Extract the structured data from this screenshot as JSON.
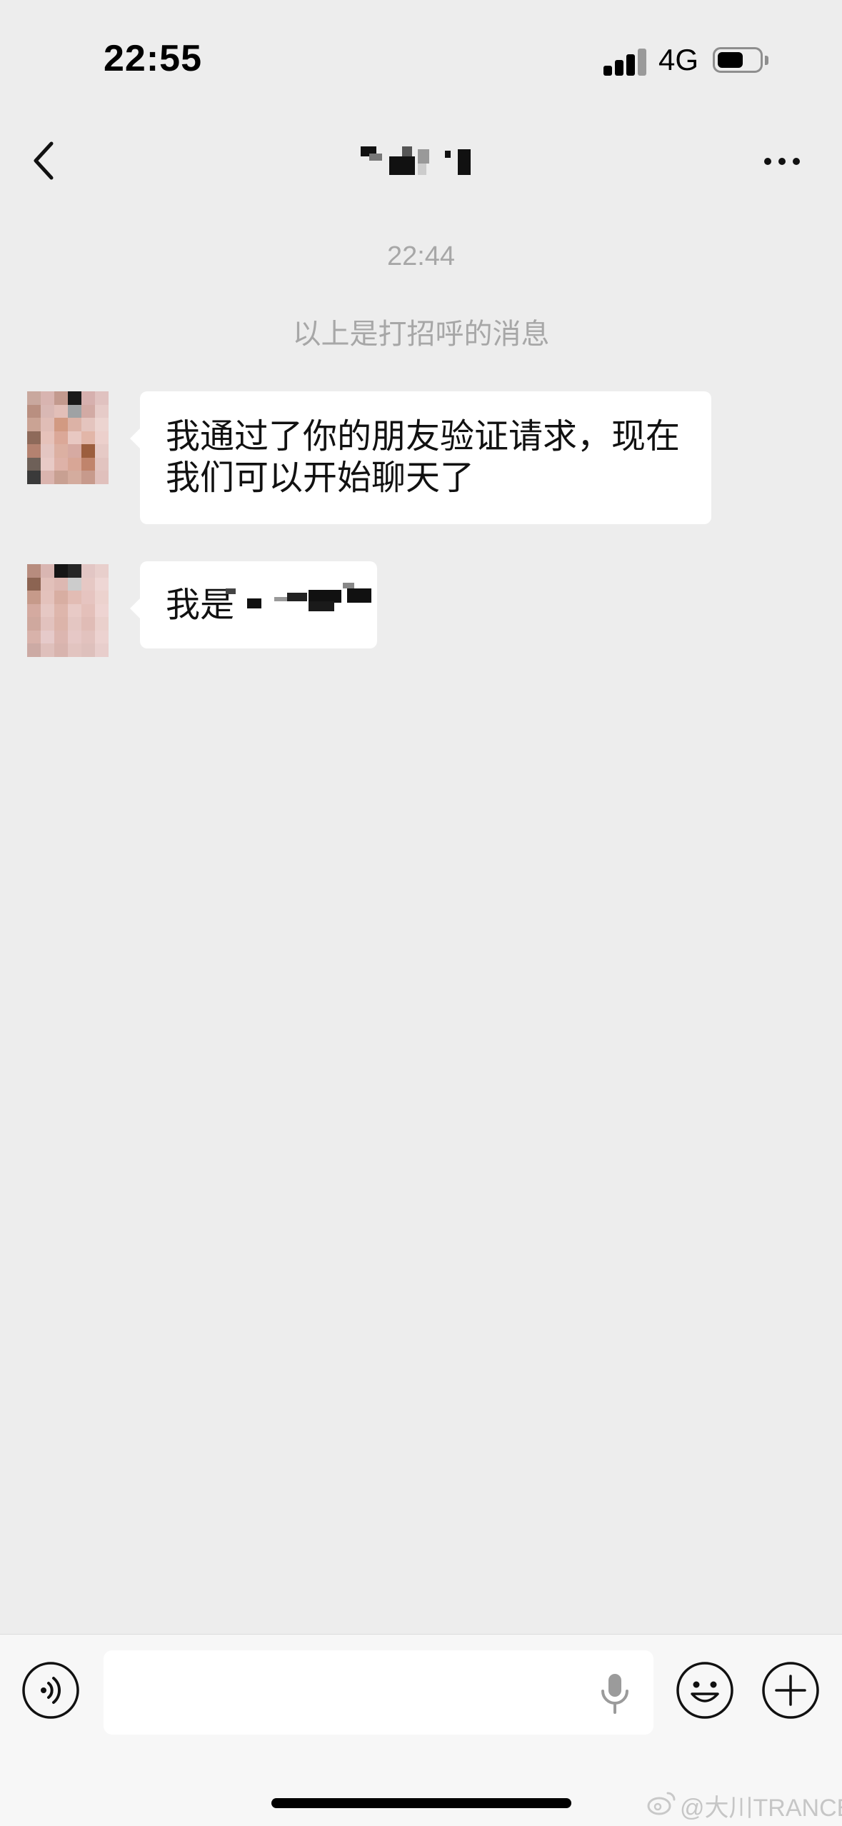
{
  "status_bar": {
    "time": "22:55",
    "network": "4G",
    "signal_bars_active": 3,
    "signal_bars_total": 4,
    "battery_level": 0.6
  },
  "nav": {
    "back_icon": "chevron-left-icon",
    "title_redacted": true,
    "more_icon": "ellipsis-icon"
  },
  "chat": {
    "timestamp": "22:44",
    "system_note": "以上是打招呼的消息",
    "messages": [
      {
        "sender": "contact",
        "text": "我通过了你的朋友验证请求，现在我们可以开始聊天了",
        "redacted": false
      },
      {
        "sender": "contact",
        "text": "我是",
        "redacted": true
      }
    ]
  },
  "input_bar": {
    "voice_icon": "voice-mode-icon",
    "message_value": "",
    "mic_icon": "microphone-icon",
    "emoji_icon": "emoji-icon",
    "plus_icon": "plus-circle-icon"
  },
  "watermark": {
    "icon": "weibo-logo",
    "text": "@大川TRANCE"
  },
  "colors": {
    "background": "#ededed",
    "bubble": "#ffffff",
    "meta_text": "#a7a7a7",
    "bottom_bar": "#f7f7f7"
  }
}
